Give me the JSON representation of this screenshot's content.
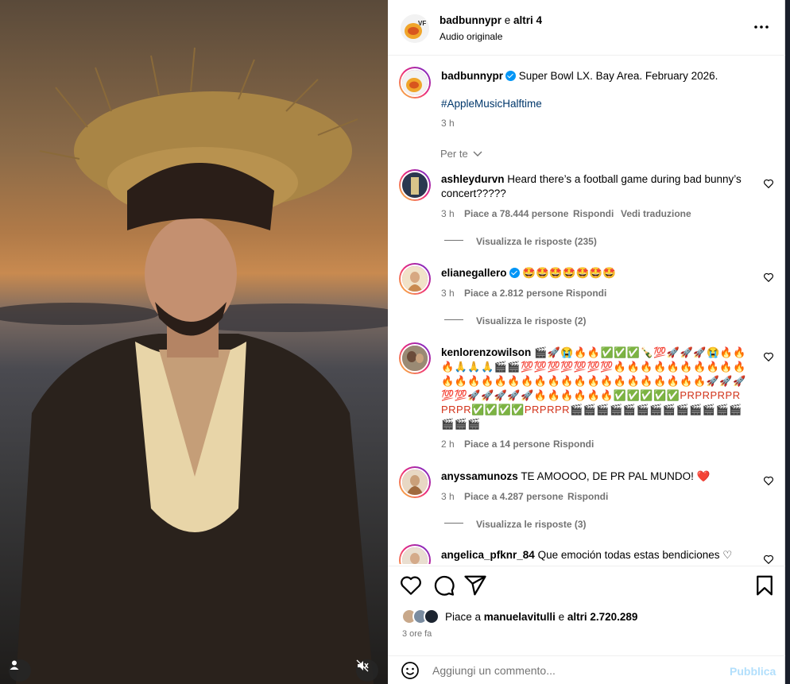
{
  "post": {
    "author": "badbunnypr",
    "collab_suffix": "e",
    "collab_others": "altri 4",
    "audio": "Audio originale",
    "more_icon": "more-horizontal-icon"
  },
  "caption": {
    "author": "badbunnypr",
    "text": "Super Bowl LX. Bay Area. February 2026.",
    "hashtag": "#AppleMusicHalftime",
    "time": "3 h"
  },
  "sort": {
    "label": "Per te"
  },
  "comments": [
    {
      "user": "ashleydurvn",
      "text": "Heard there’s a football game during bad bunny’s",
      "text2": "concert?????",
      "time": "3 h",
      "likes": "Piace a 78.444 persone",
      "reply": "Rispondi",
      "translate": "Vedi traduzione",
      "replies": "Visualizza le risposte (235)"
    },
    {
      "user": "elianegallero",
      "text": "🤩🤩🤩🤩🤩🤩🤩",
      "time": "3 h",
      "likes": "Piace a 2.812 persone",
      "reply": "Rispondi",
      "replies": "Visualizza le risposte (2)"
    },
    {
      "user": "kenlorenzowilson",
      "text": "🎬🚀😭🔥🔥✅✅✅🍾💯🚀🚀🚀😭🔥🔥🔥🙏🙏🙏🎬🎬💯💯💯💯💯💯💯🔥🔥🔥🔥🔥🔥🔥🔥🔥🔥🔥🔥🔥🔥🔥🔥🔥🔥🔥🔥🔥🔥🔥🔥🔥🔥🔥🔥🔥🔥🚀🚀🚀💯💯🚀🚀🚀🚀🚀🔥🔥🔥🔥🔥🔥✅✅✅✅✅PRPRPRPRPRPR✅✅✅✅PRPRPR🎬🎬🎬🎬🎬🎬🎬🎬🎬🎬🎬🎬🎬🎬🎬🎬",
      "time": "2 h",
      "likes": "Piace a 14 persone",
      "reply": "Rispondi"
    },
    {
      "user": "anyssamunozs",
      "text": "TE AMOOOO, DE PR PAL MUNDO! ❤️",
      "time": "3 h",
      "likes": "Piace a 4.287 persone",
      "reply": "Rispondi",
      "replies": "Visualizza le risposte (3)"
    },
    {
      "user": "angelica_pfknr_84",
      "text": "Que emoción todas estas bendiciones ♡"
    }
  ],
  "actions": {
    "like_icon": "heart-icon",
    "comment_icon": "comment-icon",
    "share_icon": "paper-plane-icon",
    "save_icon": "bookmark-icon"
  },
  "likes_summary": {
    "prefix": "Piace a",
    "user": "manuelavitulli",
    "and": "e",
    "others": "altri 2.720.289"
  },
  "post_time": "3 ore fa",
  "composer": {
    "placeholder": "Aggiungi un commento...",
    "submit": "Pubblica",
    "emoji_icon": "smiley-icon"
  },
  "media_controls": {
    "user_icon": "user-tag-icon",
    "mute_icon": "speaker-muted-icon"
  }
}
